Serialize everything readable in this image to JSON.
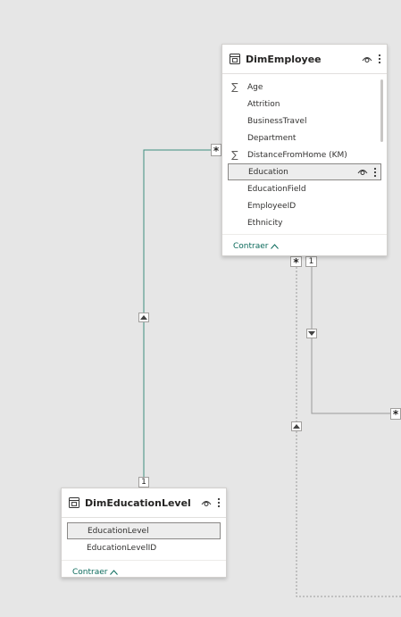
{
  "tables": {
    "employee": {
      "title": "DimEmployee",
      "fields": [
        {
          "label": "Age",
          "sigma": "∑"
        },
        {
          "label": "Attrition",
          "sigma": ""
        },
        {
          "label": "BusinessTravel",
          "sigma": ""
        },
        {
          "label": "Department",
          "sigma": ""
        },
        {
          "label": "DistanceFromHome (KM)",
          "sigma": "∑"
        },
        {
          "label": "Education",
          "sigma": ""
        },
        {
          "label": "EducationField",
          "sigma": ""
        },
        {
          "label": "EmployeeID",
          "sigma": ""
        },
        {
          "label": "Ethnicity",
          "sigma": ""
        }
      ],
      "selected_index": 5,
      "collapse_label": "Contraer"
    },
    "education": {
      "title": "DimEducationLevel",
      "fields": [
        {
          "label": "EducationLevel",
          "sigma": ""
        },
        {
          "label": "EducationLevelID",
          "sigma": ""
        }
      ],
      "selected_index": 0,
      "collapse_label": "Contraer"
    }
  },
  "relationships": {
    "many_symbol": "*",
    "one_symbol": "1"
  },
  "colors": {
    "accent": "#0b6a5b",
    "line_green": "#3f8f7f",
    "line_gray": "#9a9a9a"
  },
  "icons": {
    "table": "table-icon",
    "visibility": "eye-icon",
    "more": "more-options-icon",
    "collapse": "chevron-up-icon",
    "arrow_up": "arrow-up-icon",
    "arrow_down": "arrow-down-icon"
  }
}
